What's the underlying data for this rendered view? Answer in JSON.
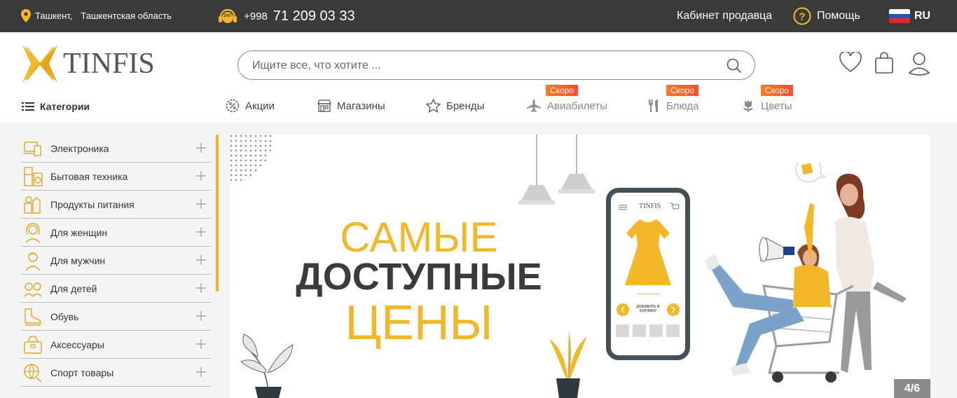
{
  "topbar": {
    "location_city": "Ташкент,",
    "location_region": "Ташкентская область",
    "phone_prefix": "+998",
    "phone_number": "71 209 03 33",
    "phone_icon_text": "24/7",
    "seller_cabinet": "Кабинет продавца",
    "help": "Помощь",
    "language": "RU"
  },
  "header": {
    "logo_text": "TINFIS",
    "search_placeholder": "Ищите все, что хотите ..."
  },
  "nav": {
    "categories": "Категории",
    "items": [
      {
        "label": "Акции",
        "icon": "discount-icon"
      },
      {
        "label": "Магазины",
        "icon": "store-icon"
      },
      {
        "label": "Бренды",
        "icon": "star-icon"
      },
      {
        "label": "Авиабилеты",
        "icon": "plane-icon",
        "badge": "Скоро"
      },
      {
        "label": "Блюда",
        "icon": "fork-knife-icon",
        "badge": "Скоро"
      },
      {
        "label": "Цветы",
        "icon": "flower-icon",
        "badge": "Скоро"
      }
    ]
  },
  "sidebar": {
    "items": [
      {
        "label": "Электроника"
      },
      {
        "label": "Бытовая техника"
      },
      {
        "label": "Продукты питания"
      },
      {
        "label": "Для женщин"
      },
      {
        "label": "Для мужчин"
      },
      {
        "label": "Для детей"
      },
      {
        "label": "Обувь"
      },
      {
        "label": "Аксессуары"
      },
      {
        "label": "Спорт товары"
      }
    ]
  },
  "banner": {
    "line1": "САМЫЕ",
    "line2": "ДОСТУПНЫЕ",
    "line3": "ЦЕНЫ",
    "phone_logo": "TINFIS",
    "add_to_cart": "ДОБАВИТЬ В КОРЗИНУ",
    "counter": "4/6"
  },
  "colors": {
    "accent": "#f3b829",
    "topbar": "#3a3a3a",
    "badge": "#ff5a2c"
  }
}
